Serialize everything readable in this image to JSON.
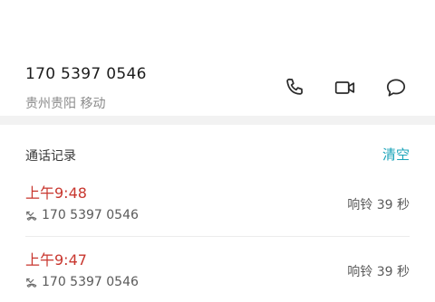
{
  "contact": {
    "phone": "170 5397 0546",
    "location": "贵州贵阳 移动"
  },
  "actions": {
    "call_icon": "phone-icon",
    "video_icon": "video-icon",
    "message_icon": "message-icon"
  },
  "call_log": {
    "header": "通话记录",
    "clear_label": "清空",
    "entries": [
      {
        "time": "上午9:48",
        "number": "170 5397 0546",
        "status": "响铃 39 秒"
      },
      {
        "time": "上午9:47",
        "number": "170 5397 0546",
        "status": "响铃 39 秒"
      }
    ]
  },
  "colors": {
    "accent": "#1aa3b9",
    "missed": "#c8362e",
    "separator": "#f2f2f2"
  }
}
